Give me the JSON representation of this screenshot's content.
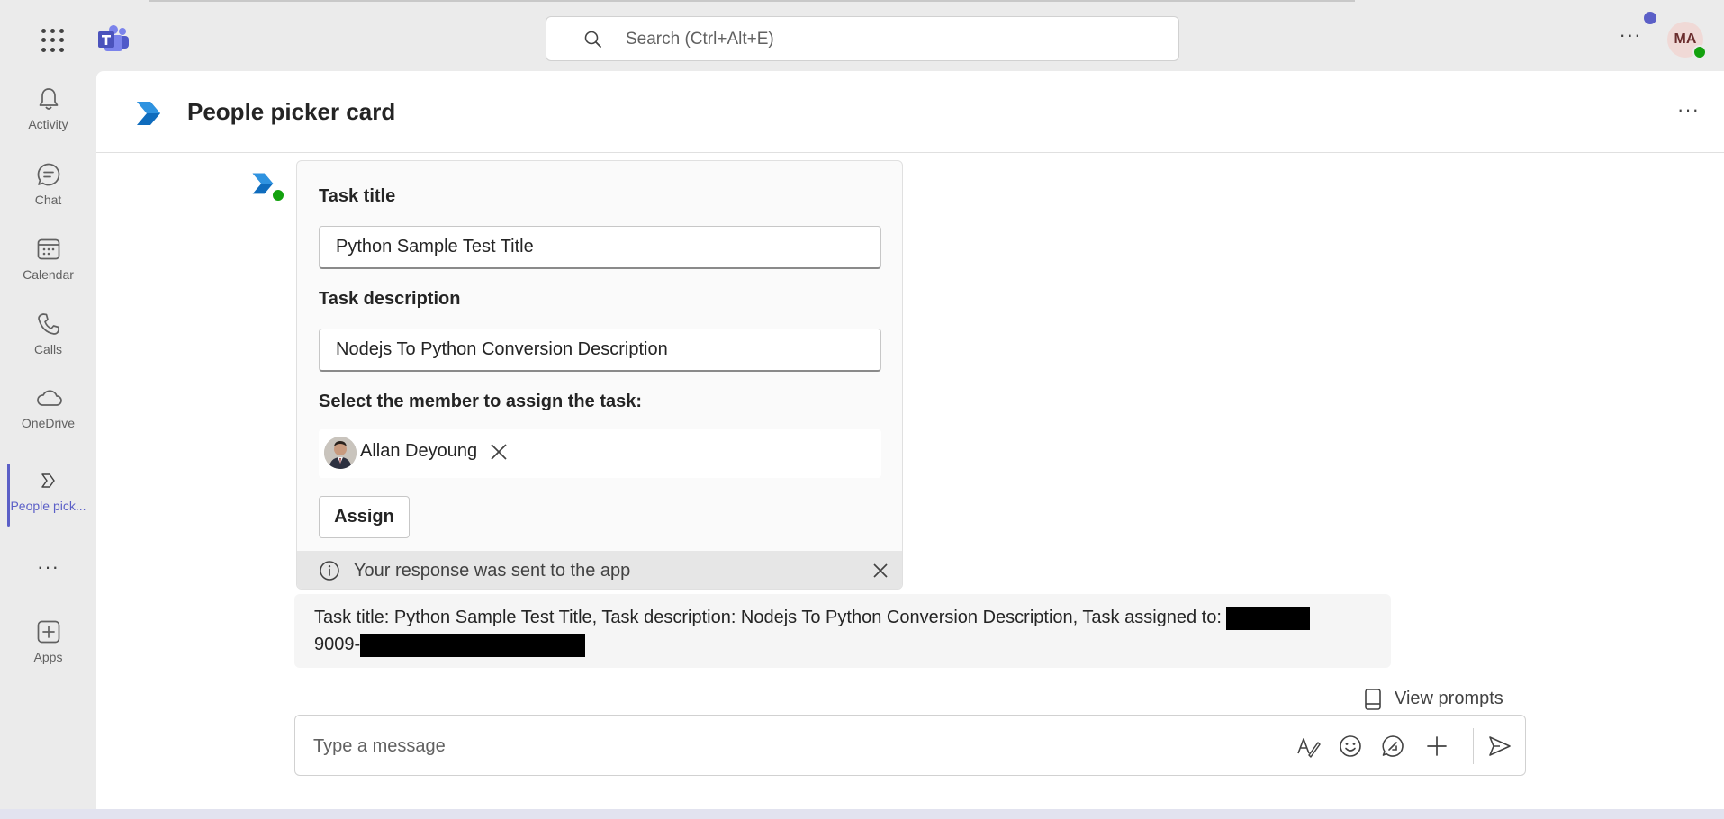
{
  "topbar": {
    "search_placeholder": "Search (Ctrl+Alt+E)",
    "more_label": "···",
    "user_initials": "MA"
  },
  "rail": {
    "items": [
      {
        "label": "Activity",
        "icon": "bell-icon"
      },
      {
        "label": "Chat",
        "icon": "chat-icon"
      },
      {
        "label": "Calendar",
        "icon": "calendar-icon"
      },
      {
        "label": "Calls",
        "icon": "phone-icon"
      },
      {
        "label": "OneDrive",
        "icon": "cloud-icon"
      },
      {
        "label": "People pick...",
        "icon": "app-icon",
        "active": true
      },
      {
        "label": "Apps",
        "icon": "add-app-icon"
      }
    ],
    "more_label": "···"
  },
  "header": {
    "title": "People picker card",
    "more_label": "···"
  },
  "card": {
    "task_title_label": "Task title",
    "task_title_value": "Python Sample Test Title",
    "task_description_label": "Task description",
    "task_description_value": "Nodejs To Python Conversion Description",
    "member_label": "Select the member to assign the task:",
    "selected_member": "Allan Deyoung",
    "assign_button": "Assign",
    "status_text": "Your response was sent to the app"
  },
  "reply": {
    "text_part1": "Task title: Python Sample Test Title, Task description: Nodejs To Python Conversion Description, Task assigned to:",
    "text_part2": "9009-"
  },
  "compose": {
    "view_prompts": "View prompts",
    "placeholder": "Type a message"
  },
  "colors": {
    "accent": "#5b5fc7",
    "presence": "#13a10e",
    "background": "#ebebeb"
  }
}
